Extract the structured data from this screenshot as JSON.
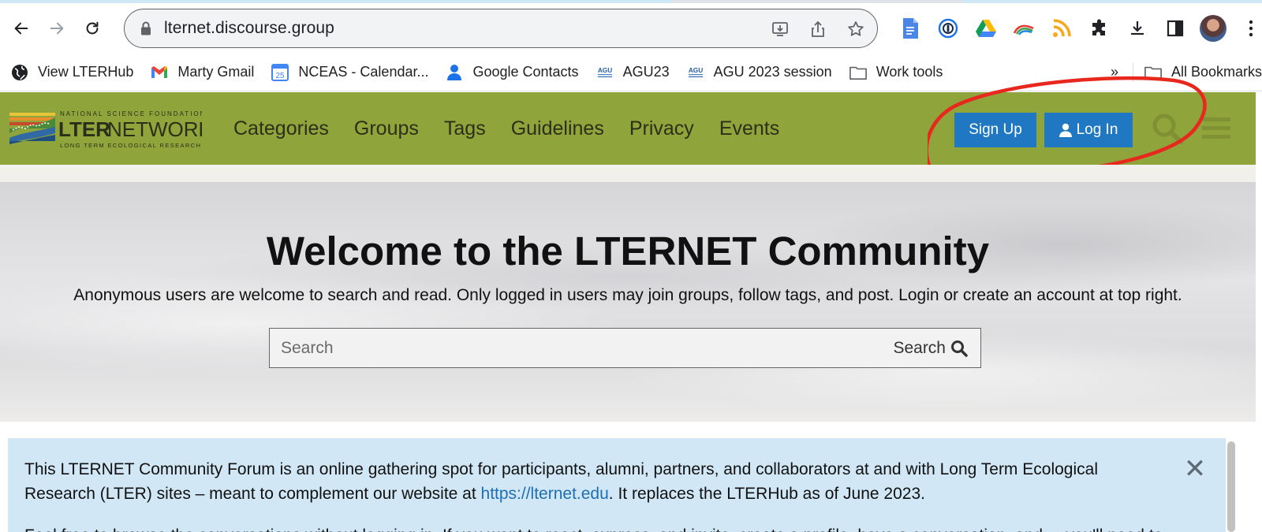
{
  "browser": {
    "url": "lternet.discourse.group",
    "bookmarks": [
      {
        "label": "View LTERHub",
        "icon": "globe-icon"
      },
      {
        "label": "Marty Gmail",
        "icon": "gmail-icon"
      },
      {
        "label": "NCEAS - Calendar...",
        "icon": "calendar-icon",
        "badge": "25"
      },
      {
        "label": "Google Contacts",
        "icon": "contacts-icon"
      },
      {
        "label": "AGU23",
        "icon": "agu-icon"
      },
      {
        "label": "AGU 2023 session",
        "icon": "agu-icon"
      },
      {
        "label": "Work tools",
        "icon": "folder-icon"
      }
    ],
    "bookmarks_overflow": "»",
    "all_bookmarks": "All Bookmarks"
  },
  "site": {
    "logo": {
      "top_text": "NATIONAL SCIENCE FOUNDATION",
      "name_bold": "LTER",
      "name_light": "NETWORK",
      "bottom_text": "LONG TERM ECOLOGICAL RESEARCH"
    },
    "nav": [
      "Categories",
      "Groups",
      "Tags",
      "Guidelines",
      "Privacy",
      "Events"
    ],
    "signup_label": "Sign Up",
    "login_label": "Log In",
    "header_color": "#8fa43a",
    "button_color": "#1f78c1"
  },
  "hero": {
    "title": "Welcome to the LTERNET Community",
    "subtitle": "Anonymous users are welcome to search and read. Only logged in users may join groups, follow tags, and post. Login or create an account at top right.",
    "search_placeholder": "Search",
    "search_button": "Search"
  },
  "notice": {
    "text_before_link": "This LTERNET Community Forum is an online gathering spot for participants, alumni, partners, and collaborators at and with Long Term Ecological Research (LTER) sites – meant to complement our website at ",
    "link": "https://lternet.edu",
    "text_after_link": ". It replaces the LTERHub as of June 2023.",
    "second_paragraph_partial": "Feel free to browse the conversations without logging in. If you want to react, express, and invite, create a profile, have a conversation, and ... you'll need to",
    "close_glyph": "✕",
    "background": "#d1e7f5"
  },
  "annotation": {
    "color": "#e8271d"
  }
}
